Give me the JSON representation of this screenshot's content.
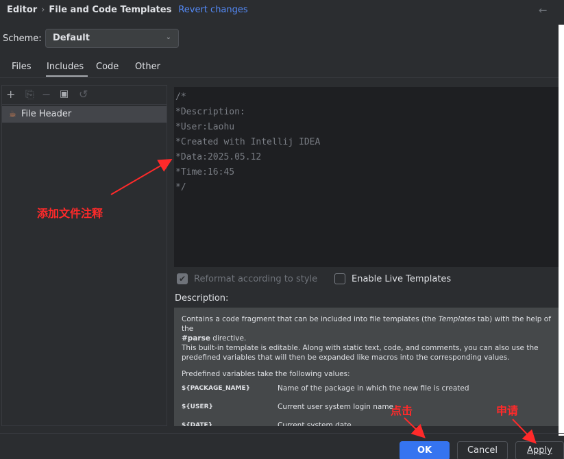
{
  "header": {
    "crumb_root": "Editor",
    "crumb_sep": "›",
    "crumb_page": "File and Code Templates",
    "revert_label": "Revert changes",
    "back_icon": "back-arrow-icon"
  },
  "scheme": {
    "label": "Scheme:",
    "value": "Default"
  },
  "tabs": [
    {
      "label": "Files"
    },
    {
      "label": "Includes"
    },
    {
      "label": "Code"
    },
    {
      "label": "Other"
    }
  ],
  "selected_tab": "Includes",
  "tree": {
    "items": [
      {
        "label": "File Header",
        "icon": "template-icon"
      }
    ]
  },
  "editor": {
    "lines": [
      "/*",
      "*Description:",
      "*User:Laohu",
      "*Created with Intellij IDEA",
      "*Data:2025.05.12",
      "*Time:16:45",
      "*/"
    ]
  },
  "options": {
    "reformat_label": "Reformat according to style",
    "reformat_checked": true,
    "live_label": "Enable Live Templates",
    "live_checked": false
  },
  "description": {
    "label": "Description:",
    "p1_a": "Contains a code fragment that can be included into file templates (the ",
    "p1_em": "Templates",
    "p1_b": " tab) with the help of the",
    "p1_code": "#parse",
    "p1_c": " directive.",
    "p2": "This built-in template is editable. Along with static text, code, and comments, you can also use the predefined variables that will then be expanded like macros into the corresponding values.",
    "p3": "Predefined variables take the following values:",
    "vars": [
      {
        "name": "${PACKAGE_NAME}",
        "desc": "Name of the package in which the new file is created"
      },
      {
        "name": "${USER}",
        "desc": "Current user system login name"
      },
      {
        "name": "${DATE}",
        "desc": "Current system date"
      }
    ]
  },
  "footer": {
    "ok": "OK",
    "cancel": "Cancel",
    "apply": "Apply"
  },
  "annotations": {
    "add_comment": "添加文件注释",
    "click": "点击",
    "apply_cn": "申请"
  },
  "colors": {
    "accent": "#3574f0",
    "link": "#548af7",
    "annotation": "#ff2a2a"
  }
}
